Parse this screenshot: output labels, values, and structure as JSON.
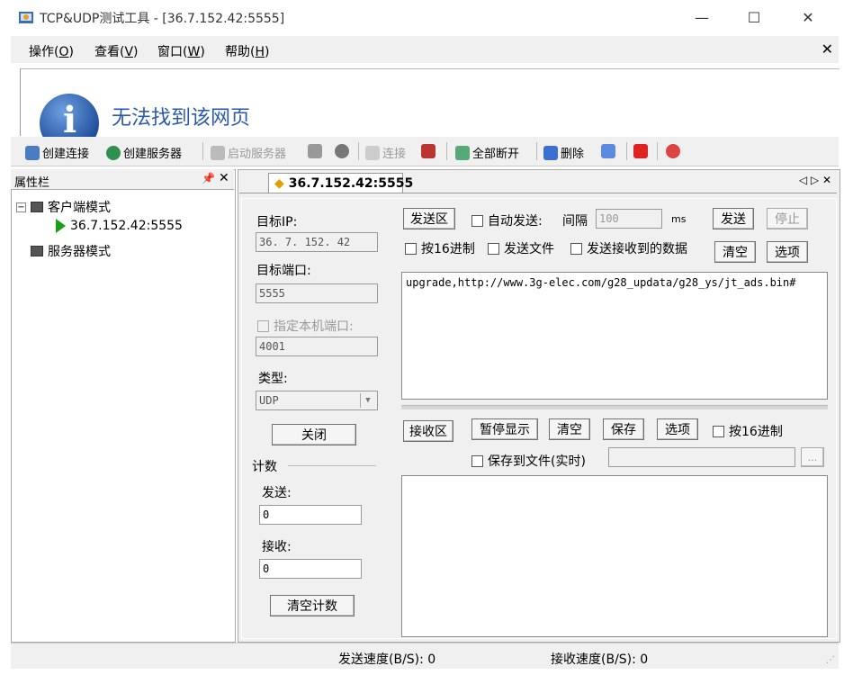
{
  "window": {
    "title": "TCP&UDP测试工具 - [36.7.152.42:5555]"
  },
  "menu": [
    {
      "label": "操作",
      "key": "O"
    },
    {
      "label": "查看",
      "key": "V"
    },
    {
      "label": "窗口",
      "key": "W"
    },
    {
      "label": "帮助",
      "key": "H"
    }
  ],
  "web": {
    "message": "无法找到该网页"
  },
  "toolbar": {
    "create_conn": "创建连接",
    "create_server": "创建服务器",
    "start_server": "启动服务器",
    "connect": "连接",
    "disconnect_all": "全部断开",
    "delete": "删除"
  },
  "sidebar": {
    "title": "属性栏",
    "pin": "ᵼ",
    "client_mode": "客户端模式",
    "connection": "36.7.152.42:5555",
    "server_mode": "服务器模式"
  },
  "tab": {
    "label": "36.7.152.42:5555",
    "nav": "◁ ▷ ✕"
  },
  "config": {
    "target_ip_label": "目标IP:",
    "target_ip": "36. 7. 152. 42",
    "target_port_label": "目标端口:",
    "target_port": "5555",
    "local_port_label": "指定本机端口:",
    "local_port": "4001",
    "type_label": "类型:",
    "type_value": "UDP",
    "close_button": "关闭",
    "count_label": "计数",
    "send_label": "发送:",
    "send_count": "0",
    "recv_label": "接收:",
    "recv_count": "0",
    "clear_count_button": "清空计数"
  },
  "send": {
    "area_button": "发送区",
    "auto_send": "自动发送:",
    "interval_label": "间隔",
    "interval_placeholder": "100",
    "interval_unit": "ms",
    "send_button": "发送",
    "stop_button": "停止",
    "hex_label": "按16进制",
    "send_file_label": "发送文件",
    "send_received_label": "发送接收到的数据",
    "clear_button": "清空",
    "options_button": "选项",
    "content": "upgrade,http://www.3g-elec.com/g28_updata/g28_ys/jt_ads.bin#"
  },
  "receive": {
    "area_button": "接收区",
    "pause_button": "暂停显示",
    "clear_button": "清空",
    "save_button": "保存",
    "options_button": "选项",
    "hex_label": "按16进制",
    "save_to_file_label": "保存到文件(实时)",
    "browse_button": "..."
  },
  "status": {
    "send_speed": "发送速度(B/S): 0",
    "recv_speed": "接收速度(B/S): 0"
  }
}
